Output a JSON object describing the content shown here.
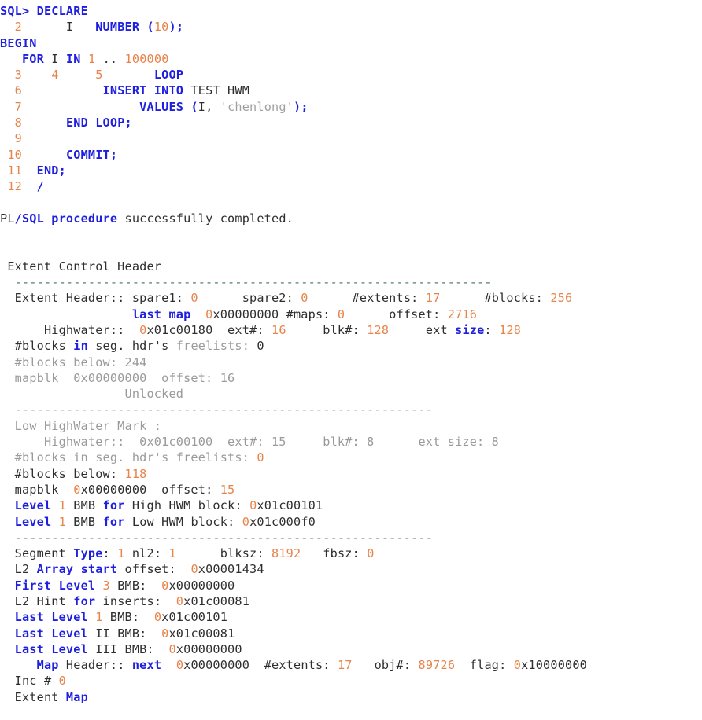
{
  "terminal": {
    "prompt": "SQL> ",
    "app": "SQL*Plus"
  },
  "code_lines": [
    {
      "id": "line-declare",
      "segments": [
        {
          "t": "SQL>",
          "c": "kw"
        },
        {
          "t": " ",
          "c": "plain"
        },
        {
          "t": "DECLARE",
          "c": "kw"
        }
      ]
    },
    {
      "id": "line-2-number",
      "segments": [
        {
          "t": "  ",
          "c": "plain"
        },
        {
          "t": "2",
          "c": "num"
        },
        {
          "t": "      I   ",
          "c": "plain"
        },
        {
          "t": "NUMBER",
          "c": "kw"
        },
        {
          "t": " ",
          "c": "plain"
        },
        {
          "t": "(",
          "c": "kw"
        },
        {
          "t": "10",
          "c": "num"
        },
        {
          "t": ");",
          "c": "kw"
        }
      ]
    },
    {
      "id": "line-begin",
      "segments": [
        {
          "t": "BEGIN",
          "c": "kw"
        }
      ]
    },
    {
      "id": "line-for",
      "segments": [
        {
          "t": "   ",
          "c": "plain"
        },
        {
          "t": "FOR",
          "c": "kw"
        },
        {
          "t": " I ",
          "c": "plain"
        },
        {
          "t": "IN",
          "c": "kw"
        },
        {
          "t": " ",
          "c": "plain"
        },
        {
          "t": "1",
          "c": "num"
        },
        {
          "t": " ",
          "c": "plain"
        },
        {
          "t": "..",
          "c": "plain"
        },
        {
          "t": " ",
          "c": "plain"
        },
        {
          "t": "100000",
          "c": "num"
        }
      ]
    },
    {
      "id": "line-345-loop",
      "segments": [
        {
          "t": "  ",
          "c": "plain"
        },
        {
          "t": "3",
          "c": "num"
        },
        {
          "t": "    ",
          "c": "plain"
        },
        {
          "t": "4",
          "c": "num"
        },
        {
          "t": "     ",
          "c": "plain"
        },
        {
          "t": "5",
          "c": "num"
        },
        {
          "t": "       ",
          "c": "plain"
        },
        {
          "t": "LOOP",
          "c": "kw"
        }
      ]
    },
    {
      "id": "line-6-insert",
      "segments": [
        {
          "t": "  ",
          "c": "plain"
        },
        {
          "t": "6",
          "c": "num"
        },
        {
          "t": "           ",
          "c": "plain"
        },
        {
          "t": "INSERT INTO",
          "c": "kw"
        },
        {
          "t": " TEST_HWM",
          "c": "plain"
        }
      ]
    },
    {
      "id": "line-7-values",
      "segments": [
        {
          "t": "  ",
          "c": "plain"
        },
        {
          "t": "7",
          "c": "num"
        },
        {
          "t": "                ",
          "c": "plain"
        },
        {
          "t": "VALUES",
          "c": "kw"
        },
        {
          "t": " ",
          "c": "plain"
        },
        {
          "t": "(",
          "c": "kw"
        },
        {
          "t": "I, ",
          "c": "plain"
        },
        {
          "t": "'chenlong'",
          "c": "str"
        },
        {
          "t": ");",
          "c": "kw"
        }
      ]
    },
    {
      "id": "line-8-endloop",
      "segments": [
        {
          "t": "  ",
          "c": "plain"
        },
        {
          "t": "8",
          "c": "num"
        },
        {
          "t": "      ",
          "c": "plain"
        },
        {
          "t": "END LOOP;",
          "c": "kw"
        }
      ]
    },
    {
      "id": "line-9",
      "segments": [
        {
          "t": "  ",
          "c": "plain"
        },
        {
          "t": "9",
          "c": "num"
        }
      ]
    },
    {
      "id": "line-10-commit",
      "segments": [
        {
          "t": " ",
          "c": "plain"
        },
        {
          "t": "10",
          "c": "num"
        },
        {
          "t": "      ",
          "c": "plain"
        },
        {
          "t": "COMMIT;",
          "c": "kw"
        }
      ]
    },
    {
      "id": "line-11-end",
      "segments": [
        {
          "t": " ",
          "c": "plain"
        },
        {
          "t": "11",
          "c": "num"
        },
        {
          "t": "  ",
          "c": "plain"
        },
        {
          "t": "END;",
          "c": "kw"
        }
      ]
    },
    {
      "id": "line-12-slash",
      "segments": [
        {
          "t": " ",
          "c": "plain"
        },
        {
          "t": "12",
          "c": "num"
        },
        {
          "t": "  ",
          "c": "plain"
        },
        {
          "t": "/",
          "c": "kw"
        }
      ]
    },
    {
      "id": "blank-1",
      "segments": []
    },
    {
      "id": "line-result",
      "segments": [
        {
          "t": "PL",
          "c": "plain"
        },
        {
          "t": "/",
          "c": "kw"
        },
        {
          "t": "SQL procedure",
          "c": "kw"
        },
        {
          "t": " successfully completed.",
          "c": "plain"
        }
      ]
    }
  ],
  "dump_lines": [
    {
      "id": "blank-2",
      "segments": []
    },
    {
      "id": "blank-3",
      "segments": []
    },
    {
      "id": "line-extent-control-header",
      "segments": [
        {
          "t": " Extent Control Header",
          "c": "plain"
        }
      ]
    },
    {
      "id": "separator-1",
      "segments": [
        {
          "t": "  -----------------------------------------------------------------",
          "c": "sep-green"
        }
      ]
    },
    {
      "id": "line-extent-header",
      "segments": [
        {
          "t": "  Extent Header:: spare1: ",
          "c": "plain"
        },
        {
          "t": "0",
          "c": "num"
        },
        {
          "t": "      spare2: ",
          "c": "plain"
        },
        {
          "t": "0",
          "c": "num"
        },
        {
          "t": "      #extents: ",
          "c": "plain"
        },
        {
          "t": "17",
          "c": "num"
        },
        {
          "t": "      #blocks: ",
          "c": "plain"
        },
        {
          "t": "256",
          "c": "num"
        }
      ]
    },
    {
      "id": "line-last-map",
      "segments": [
        {
          "t": "                  ",
          "c": "plain"
        },
        {
          "t": "last map",
          "c": "kw"
        },
        {
          "t": "  ",
          "c": "plain"
        },
        {
          "t": "0",
          "c": "num"
        },
        {
          "t": "x00000000",
          "c": "plain"
        },
        {
          "t": " #maps: ",
          "c": "plain"
        },
        {
          "t": "0",
          "c": "num"
        },
        {
          "t": "      offset: ",
          "c": "plain"
        },
        {
          "t": "2716",
          "c": "num"
        }
      ]
    },
    {
      "id": "line-highwater-high",
      "segments": [
        {
          "t": "      Highwater::  ",
          "c": "plain"
        },
        {
          "t": "0",
          "c": "num"
        },
        {
          "t": "x01c00180",
          "c": "plain"
        },
        {
          "t": "  ext#: ",
          "c": "plain"
        },
        {
          "t": "16",
          "c": "num"
        },
        {
          "t": "     blk#: ",
          "c": "plain"
        },
        {
          "t": "128",
          "c": "num"
        },
        {
          "t": "     ext ",
          "c": "plain"
        },
        {
          "t": "size",
          "c": "kw"
        },
        {
          "t": ": ",
          "c": "plain"
        },
        {
          "t": "128",
          "c": "num"
        }
      ]
    },
    {
      "id": "line-blocks-freelists-high",
      "segments": [
        {
          "t": "  #blocks ",
          "c": "plain"
        },
        {
          "t": "in",
          "c": "kw"
        },
        {
          "t": " seg. hdr's ",
          "c": "plain"
        },
        {
          "t": "freelists: ",
          "c": "dim"
        },
        {
          "t": "0",
          "c": "plain"
        }
      ]
    },
    {
      "id": "line-blocks-below-high",
      "segments": [
        {
          "t": "  #blocks below: 244",
          "c": "dim"
        }
      ]
    },
    {
      "id": "line-mapblk-high",
      "segments": [
        {
          "t": "  mapblk  0x00000000  offset: 16",
          "c": "dim"
        }
      ]
    },
    {
      "id": "line-unlocked",
      "segments": [
        {
          "t": "                 Unlocked",
          "c": "dim"
        }
      ]
    },
    {
      "id": "separator-2",
      "segments": [
        {
          "t": "  ---------------------------------------------------------",
          "c": "sep-grey"
        }
      ]
    },
    {
      "id": "line-low-hwm-title",
      "segments": [
        {
          "t": "  Low HighWater Mark :",
          "c": "dim"
        }
      ]
    },
    {
      "id": "line-highwater-low",
      "segments": [
        {
          "t": "      Highwater::  0x01c00100  ext#: 15     blk#: 8      ext size: 8",
          "c": "dim"
        }
      ]
    },
    {
      "id": "line-blocks-freelists-low",
      "segments": [
        {
          "t": "  #blocks in seg. hdr's freelists: ",
          "c": "dim"
        },
        {
          "t": "0",
          "c": "num"
        }
      ]
    },
    {
      "id": "line-blocks-below-low",
      "segments": [
        {
          "t": "  #blocks below: ",
          "c": "plain"
        },
        {
          "t": "118",
          "c": "num"
        }
      ]
    },
    {
      "id": "line-mapblk-low",
      "segments": [
        {
          "t": "  mapblk  ",
          "c": "plain"
        },
        {
          "t": "0",
          "c": "num"
        },
        {
          "t": "x00000000  offset: ",
          "c": "plain"
        },
        {
          "t": "15",
          "c": "num"
        }
      ]
    },
    {
      "id": "line-level1-high-hwm",
      "segments": [
        {
          "t": "  ",
          "c": "plain"
        },
        {
          "t": "Level",
          "c": "kw"
        },
        {
          "t": " ",
          "c": "plain"
        },
        {
          "t": "1",
          "c": "num"
        },
        {
          "t": " BMB ",
          "c": "plain"
        },
        {
          "t": "for",
          "c": "kw"
        },
        {
          "t": " High HWM block: ",
          "c": "plain"
        },
        {
          "t": "0",
          "c": "num"
        },
        {
          "t": "x01c00101",
          "c": "plain"
        }
      ]
    },
    {
      "id": "line-level1-low-hwm",
      "segments": [
        {
          "t": "  ",
          "c": "plain"
        },
        {
          "t": "Level",
          "c": "kw"
        },
        {
          "t": " ",
          "c": "plain"
        },
        {
          "t": "1",
          "c": "num"
        },
        {
          "t": " BMB ",
          "c": "plain"
        },
        {
          "t": "for",
          "c": "kw"
        },
        {
          "t": " Low HWM block: ",
          "c": "plain"
        },
        {
          "t": "0",
          "c": "num"
        },
        {
          "t": "x01c000f0",
          "c": "plain"
        }
      ]
    },
    {
      "id": "separator-3",
      "segments": [
        {
          "t": "  ---------------------------------------------------------",
          "c": "sep-green"
        }
      ]
    },
    {
      "id": "line-segment-type",
      "segments": [
        {
          "t": "  Segment ",
          "c": "plain"
        },
        {
          "t": "Type",
          "c": "kw"
        },
        {
          "t": ": ",
          "c": "plain"
        },
        {
          "t": "1",
          "c": "num"
        },
        {
          "t": " nl2: ",
          "c": "plain"
        },
        {
          "t": "1",
          "c": "num"
        },
        {
          "t": "      blksz: ",
          "c": "plain"
        },
        {
          "t": "8192",
          "c": "num"
        },
        {
          "t": "   fbsz: ",
          "c": "plain"
        },
        {
          "t": "0",
          "c": "num"
        }
      ]
    },
    {
      "id": "line-l2-array-start",
      "segments": [
        {
          "t": "  L2 ",
          "c": "plain"
        },
        {
          "t": "Array start",
          "c": "kw"
        },
        {
          "t": " offset:  ",
          "c": "plain"
        },
        {
          "t": "0",
          "c": "num"
        },
        {
          "t": "x00001434",
          "c": "plain"
        }
      ]
    },
    {
      "id": "line-first-level-3-bmb",
      "segments": [
        {
          "t": "  ",
          "c": "plain"
        },
        {
          "t": "First Level",
          "c": "kw"
        },
        {
          "t": " ",
          "c": "plain"
        },
        {
          "t": "3",
          "c": "num"
        },
        {
          "t": " BMB:  ",
          "c": "plain"
        },
        {
          "t": "0",
          "c": "num"
        },
        {
          "t": "x00000000",
          "c": "plain"
        }
      ]
    },
    {
      "id": "line-l2-hint-inserts",
      "segments": [
        {
          "t": "  L2 Hint ",
          "c": "plain"
        },
        {
          "t": "for",
          "c": "kw"
        },
        {
          "t": " inserts:  ",
          "c": "plain"
        },
        {
          "t": "0",
          "c": "num"
        },
        {
          "t": "x01c00081",
          "c": "plain"
        }
      ]
    },
    {
      "id": "line-last-level-1-bmb",
      "segments": [
        {
          "t": "  ",
          "c": "plain"
        },
        {
          "t": "Last Level",
          "c": "kw"
        },
        {
          "t": " ",
          "c": "plain"
        },
        {
          "t": "1",
          "c": "num"
        },
        {
          "t": " BMB:  ",
          "c": "plain"
        },
        {
          "t": "0",
          "c": "num"
        },
        {
          "t": "x01c00101",
          "c": "plain"
        }
      ]
    },
    {
      "id": "line-last-level-2-bmb",
      "segments": [
        {
          "t": "  ",
          "c": "plain"
        },
        {
          "t": "Last Level",
          "c": "kw"
        },
        {
          "t": " II BMB:  ",
          "c": "plain"
        },
        {
          "t": "0",
          "c": "num"
        },
        {
          "t": "x01c00081",
          "c": "plain"
        }
      ]
    },
    {
      "id": "line-last-level-3-bmb",
      "segments": [
        {
          "t": "  ",
          "c": "plain"
        },
        {
          "t": "Last Level",
          "c": "kw"
        },
        {
          "t": " III BMB:  ",
          "c": "plain"
        },
        {
          "t": "0",
          "c": "num"
        },
        {
          "t": "x00000000",
          "c": "plain"
        }
      ]
    },
    {
      "id": "line-map-header",
      "segments": [
        {
          "t": "     ",
          "c": "plain"
        },
        {
          "t": "Map",
          "c": "kw"
        },
        {
          "t": " Header:: ",
          "c": "plain"
        },
        {
          "t": "next",
          "c": "kw"
        },
        {
          "t": "  ",
          "c": "plain"
        },
        {
          "t": "0",
          "c": "num"
        },
        {
          "t": "x00000000",
          "c": "plain"
        },
        {
          "t": "  #extents: ",
          "c": "plain"
        },
        {
          "t": "17",
          "c": "num"
        },
        {
          "t": "   obj#: ",
          "c": "plain"
        },
        {
          "t": "89726",
          "c": "num"
        },
        {
          "t": "  flag: ",
          "c": "plain"
        },
        {
          "t": "0",
          "c": "num"
        },
        {
          "t": "x10000000",
          "c": "plain"
        }
      ]
    },
    {
      "id": "line-inc",
      "segments": [
        {
          "t": "  Inc # ",
          "c": "plain"
        },
        {
          "t": "0",
          "c": "num"
        }
      ]
    },
    {
      "id": "line-extent-map",
      "segments": [
        {
          "t": "  Extent ",
          "c": "plain"
        },
        {
          "t": "Map",
          "c": "kw"
        }
      ]
    }
  ]
}
